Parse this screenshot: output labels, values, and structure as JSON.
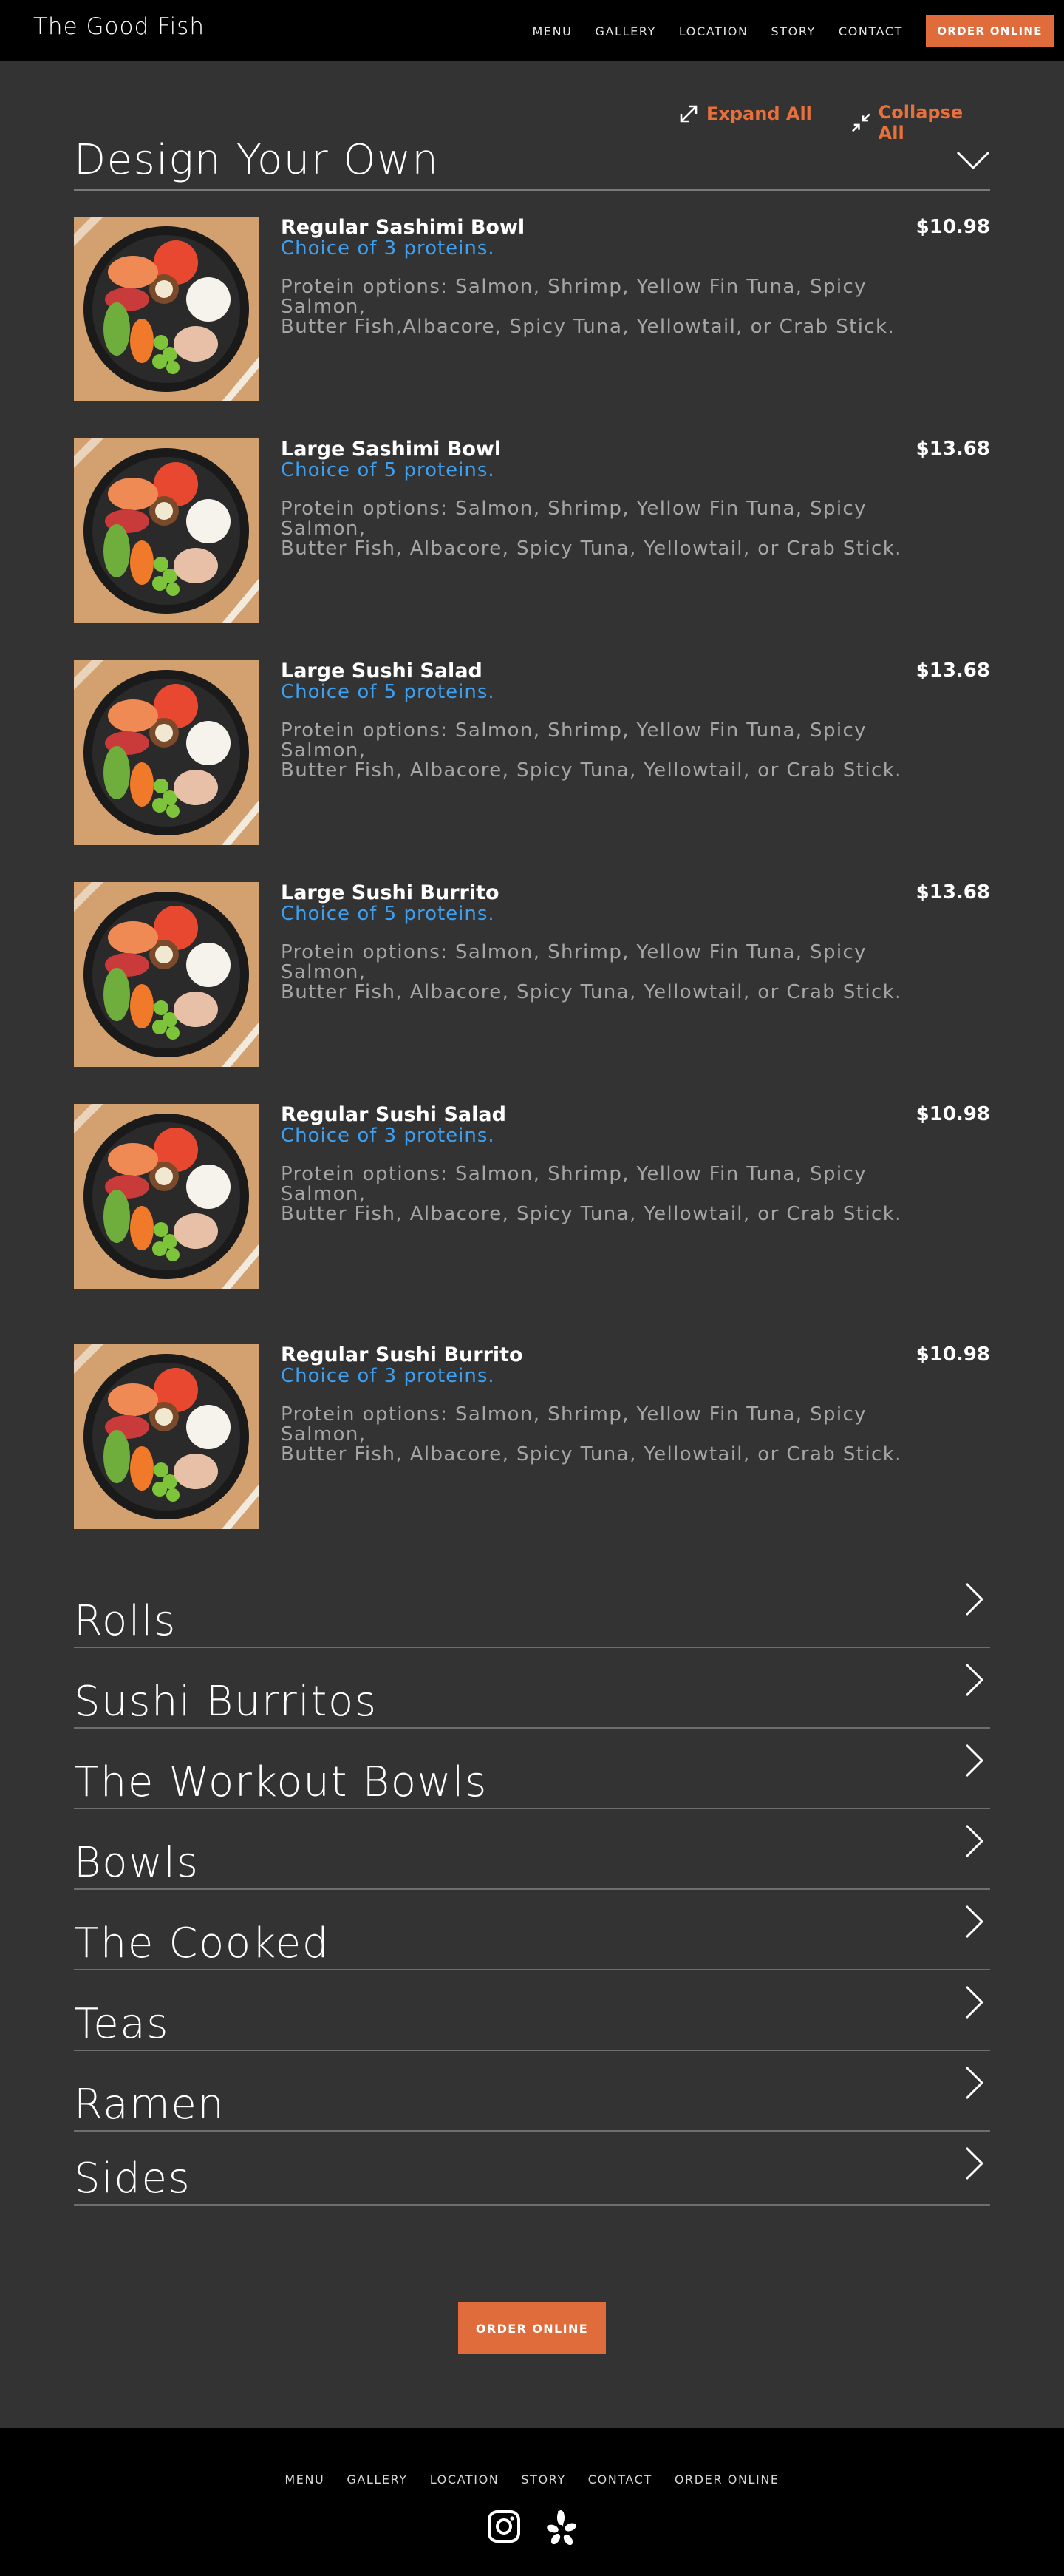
{
  "header": {
    "brand": "The Good Fish",
    "nav": [
      "MENU",
      "GALLERY",
      "LOCATION",
      "STORY",
      "CONTACT"
    ],
    "order_button": "ORDER ONLINE"
  },
  "controls": {
    "expand_all": "Expand All",
    "collapse_all": "Collapse All"
  },
  "open_section": {
    "title": "Design Your Own",
    "items": [
      {
        "name": "Regular Sashimi Bowl",
        "price": "$10.98",
        "subtitle": "Choice of 3 proteins.",
        "desc_line1": "Protein options: Salmon, Shrimp, Yellow Fin Tuna, Spicy Salmon,",
        "desc_line2": "Butter Fish,Albacore, Spicy Tuna, Yellowtail, or Crab Stick."
      },
      {
        "name": "Large Sashimi Bowl",
        "price": "$13.68",
        "subtitle": "Choice of 5 proteins.",
        "desc_line1": "Protein options: Salmon, Shrimp, Yellow Fin Tuna, Spicy Salmon,",
        "desc_line2": "Butter Fish, Albacore, Spicy Tuna, Yellowtail, or Crab Stick."
      },
      {
        "name": "Large Sushi Salad",
        "price": "$13.68",
        "subtitle": "Choice of 5 proteins.",
        "desc_line1": "Protein options: Salmon, Shrimp, Yellow Fin Tuna, Spicy Salmon,",
        "desc_line2": "Butter Fish, Albacore, Spicy Tuna, Yellowtail, or Crab Stick."
      },
      {
        "name": "Large Sushi Burrito",
        "price": "$13.68",
        "subtitle": "Choice of 5 proteins.",
        "desc_line1": "Protein options: Salmon, Shrimp, Yellow Fin Tuna, Spicy Salmon,",
        "desc_line2": "Butter Fish, Albacore, Spicy Tuna, Yellowtail, or Crab Stick."
      },
      {
        "name": "Regular Sushi Salad",
        "price": "$10.98",
        "subtitle": "Choice of 3 proteins.",
        "desc_line1": "Protein options: Salmon, Shrimp, Yellow Fin Tuna, Spicy Salmon,",
        "desc_line2": "Butter Fish, Albacore, Spicy Tuna, Yellowtail, or Crab Stick."
      },
      {
        "name": "Regular Sushi Burrito",
        "price": "$10.98",
        "subtitle": "Choice of 3 proteins.",
        "desc_line1": "Protein options: Salmon, Shrimp, Yellow Fin Tuna, Spicy Salmon,",
        "desc_line2": "Butter Fish, Albacore, Spicy Tuna, Yellowtail, or Crab Stick."
      }
    ]
  },
  "categories": [
    "Rolls",
    "Sushi Burritos",
    "The Workout Bowls",
    "Bowls",
    "The Cooked",
    "Teas",
    "Ramen",
    "Sides"
  ],
  "cta_button": "ORDER ONLINE",
  "footer": {
    "nav": [
      "MENU",
      "GALLERY",
      "LOCATION",
      "STORY",
      "CONTACT",
      "ORDER ONLINE"
    ],
    "social_icons": [
      "instagram-icon",
      "yelp-icon"
    ]
  },
  "colors": {
    "background": "#333333",
    "header_bg": "#000000",
    "accent": "#e06c3c",
    "subtitle": "#3ea0f0",
    "description": "#a6a6a6"
  }
}
